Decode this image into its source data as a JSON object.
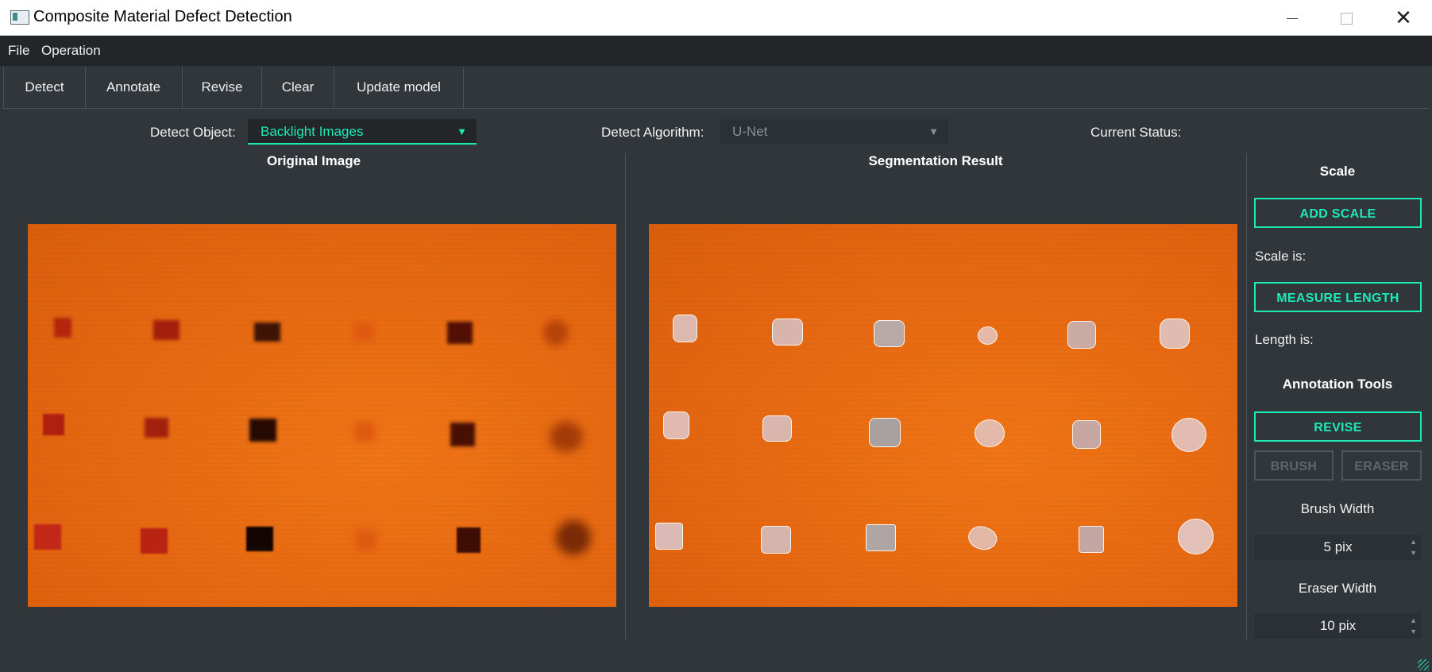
{
  "window": {
    "title": "Composite Material Defect Detection",
    "controls": {
      "minimize": "minimize",
      "maximize": "maximize",
      "close": "✕"
    }
  },
  "menu": {
    "items": [
      "File",
      "Operation"
    ]
  },
  "toolbar": {
    "buttons": [
      "Detect",
      "Annotate",
      "Revise",
      "Clear",
      "Update model"
    ]
  },
  "detect_bar": {
    "object_label": "Detect Object:",
    "object_value": "Backlight Images",
    "algorithm_label": "Detect Algorithm:",
    "algorithm_value": "U-Net",
    "status_label": "Current Status:"
  },
  "panels": {
    "original_title": "Original Image",
    "segmentation_title": "Segmentation Result"
  },
  "sidebar": {
    "scale_title": "Scale",
    "add_scale": "ADD SCALE",
    "scale_is": "Scale is:",
    "measure_length": "MEASURE LENGTH",
    "length_is": "Length is:",
    "annotation_title": "Annotation Tools",
    "revise": "REVISE",
    "brush": "BRUSH",
    "eraser": "ERASER",
    "brush_width_label": "Brush Width",
    "brush_width_value": "5 pix",
    "eraser_width_label": "Eraser Width",
    "eraser_width_value": "10 pix"
  },
  "colors": {
    "accent": "#1de9b6",
    "background": "#31363b",
    "menubar": "#232629",
    "image_orange": "#e86612",
    "mask_fill": "#d9b2a8"
  }
}
